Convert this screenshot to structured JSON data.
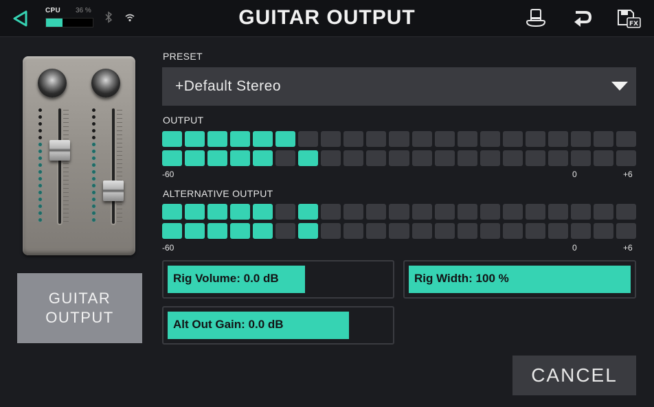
{
  "header": {
    "title": "GUITAR OUTPUT",
    "cpu_label": "CPU",
    "cpu_percent_text": "36 %",
    "cpu_level": 0.36,
    "icons": [
      "back-arrow-icon",
      "bluetooth-icon",
      "wifi-icon",
      "top-hat-icon",
      "undo-icon",
      "save-fx-icon"
    ]
  },
  "device_button": {
    "label_line1": "GUITAR",
    "label_line2": "OUTPUT"
  },
  "preset": {
    "label": "PRESET",
    "value": "+Default Stereo"
  },
  "output_meter": {
    "label": "OUTPUT",
    "segments": 21,
    "row1_lit": [
      0,
      1,
      2,
      3,
      4,
      5
    ],
    "row2_lit": [
      0,
      1,
      2,
      3,
      4,
      6
    ],
    "scale_min": "-60",
    "scale_zero": "0",
    "scale_max": "+6"
  },
  "alt_output_meter": {
    "label": "ALTERNATIVE OUTPUT",
    "segments": 21,
    "row1_lit": [
      0,
      1,
      2,
      3,
      4,
      6
    ],
    "row2_lit": [
      0,
      1,
      2,
      3,
      4,
      6
    ],
    "scale_min": "-60",
    "scale_zero": "0",
    "scale_max": "+6"
  },
  "params": {
    "rig_volume": {
      "text": "Rig Volume: 0.0 dB",
      "level": 0.62
    },
    "rig_width": {
      "text": "Rig Width: 100 %",
      "level": 1.0
    },
    "alt_out_gain": {
      "text": "Alt Out Gain: 0.0 dB",
      "level": 0.82
    }
  },
  "cancel_label": "CANCEL",
  "colors": {
    "accent": "#36d3b3",
    "background": "#1b1c20",
    "panel": "#3a3b40",
    "device_button": "#8b8d93"
  }
}
